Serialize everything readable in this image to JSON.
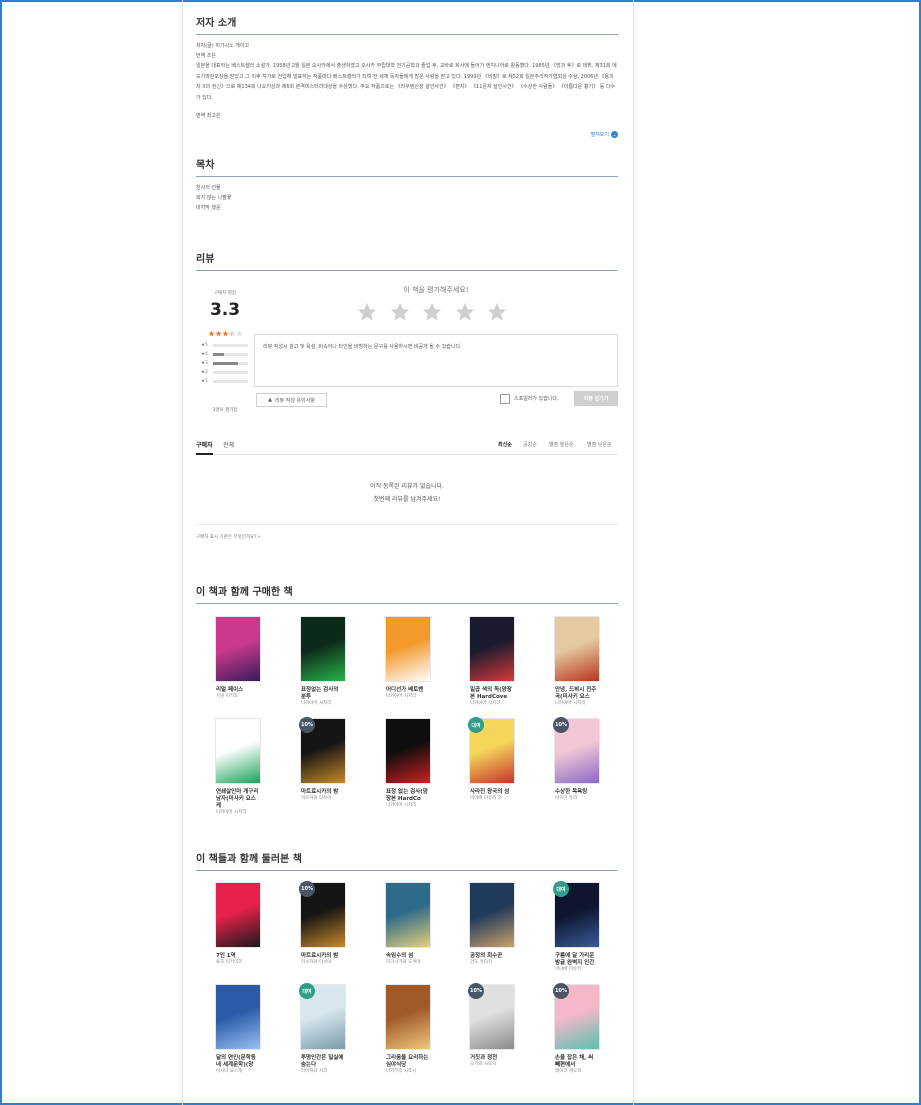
{
  "author_section": {
    "title": "저자 소개",
    "author_line": "저자(글) 히가시노 게이고",
    "translator_line": "번역 조은",
    "bio": "일본을 대표하는 베스트셀러 소설가. 1958년 2월 일본 오사카에서 출생하였고 오사카 부립대학 전기공학과 졸업 후, 교바로 회사에 들어가 엔지니어로 활동했다. 1985년 《방과 후》로 데뷔, 제31회 에도가와란포상을 받았고 그 이후 작가로 전업해 발표하는 작품마다 베스트셀러가 되며 전 세계 독자들에게 많은 사랑을 받고 있다. 1999년 《비밀》로 제52회 일본추리작가협회상 수상, 2006년 《용의자 X의 헌신》으로 제134회 나오키상과 제6회 본격미스터리대상을 수상했다. 주요 작품으로는 《라쿠텐산장 살인사건》 《편지》 《11문자 살인사건》 《수상한 사람들》 《아름다운 흉기》 등 다수가 있다.",
    "translator_label": "번역 최고은",
    "more_label": "펼쳐보기"
  },
  "toc_section": {
    "title": "목차",
    "items": [
      "천사의 선물",
      "희지 않는 나팔꽃",
      "마지막 행운"
    ]
  },
  "review_section": {
    "title": "리뷰",
    "rating_label": "구매자 별점",
    "rating_value": "3.3",
    "rating_stars": 3.3,
    "distribution": [
      {
        "label": "5",
        "fraction": 0.0
      },
      {
        "label": "4",
        "fraction": 0.3
      },
      {
        "label": "3",
        "fraction": 0.7
      },
      {
        "label": "2",
        "fraction": 0.0
      },
      {
        "label": "1",
        "fraction": 0.0
      }
    ],
    "participants_label": "3명이 평가함",
    "prompt": "이 책을 평가해주세요!",
    "textarea_placeholder": "리뷰 작성시 광고 및 욕설, 비속어나 타인을 비방하는 문구를 사용하시면 비공개 될 수 있습니다.",
    "guide_button": "리뷰 작성 유의사항",
    "spoiler_label": "스포일러가 있습니다.",
    "submit_button": "리뷰 남기기",
    "tabs": [
      "구매자",
      "전체"
    ],
    "sorts": [
      "최신순",
      "공감순",
      "별점 높은순",
      "별점 낮은순"
    ],
    "empty_line1": "아직 등록된 리뷰가 없습니다.",
    "empty_line2": "첫번째 리뷰를 남겨주세요!",
    "footer_note": "구매자 표시 기준은 무엇인가요? »",
    "star_empty_color": "#cfcfcf",
    "star_fill_color": "#f27a2a"
  },
  "bought_together": {
    "title": "이 책과 함께 구매한 책",
    "books": [
      {
        "title": "리얼 페이스",
        "author": "치넨 미키토",
        "badge": "",
        "badge_color": "",
        "colors": [
          "#c93a8c",
          "#3a1a5a"
        ]
      },
      {
        "title": "표정없는 검사의 분투",
        "author": "나카야마 시치리",
        "badge": "",
        "badge_color": "",
        "colors": [
          "#0c2a1a",
          "#29b34a"
        ]
      },
      {
        "title": "어디선가 베토벤",
        "author": "나카야마 시치리",
        "badge": "",
        "badge_color": "",
        "colors": [
          "#f39a2a",
          "#ffffff"
        ]
      },
      {
        "title": "일곱 색의 독(양장본 HardCove",
        "author": "나카야마 시치리",
        "badge": "",
        "badge_color": "",
        "colors": [
          "#1a1a2e",
          "#d63a3a"
        ]
      },
      {
        "title": "안녕, 드뷔시 전주곡(미사키 요스",
        "author": "나카야마 시치리",
        "badge": "",
        "badge_color": "",
        "colors": [
          "#e5c9a0",
          "#b8351d"
        ]
      },
      {
        "title": "연쇄살인마 개구리남자(미사키 요스케",
        "author": "나카야마 시치리",
        "badge": "",
        "badge_color": "",
        "colors": [
          "#ffffff",
          "#1aa35a"
        ]
      },
      {
        "title": "마트료시카의 밤",
        "author": "미쓰카와 다쓰야",
        "badge": "10%",
        "badge_color": "#4a5566",
        "colors": [
          "#151515",
          "#c88a2a"
        ]
      },
      {
        "title": "표정 없는 검사(양장본 HardCo",
        "author": "나카야마 시치리",
        "badge": "",
        "badge_color": "",
        "colors": [
          "#0e0e0e",
          "#d02020"
        ]
      },
      {
        "title": "사라진 왕국의 성",
        "author": "미야베 미유키 외",
        "badge": "대여",
        "badge_color": "#2e9e8a",
        "colors": [
          "#f5d55a",
          "#c8332a"
        ]
      },
      {
        "title": "수상한 목욕탕",
        "author": "아즈마 유리",
        "badge": "10%",
        "badge_color": "#4a5566",
        "colors": [
          "#f2c6d4",
          "#8a6ac8"
        ]
      }
    ]
  },
  "viewed_together": {
    "title": "이 책들과 함께 둘러본 책",
    "books": [
      {
        "title": "7인 1역",
        "author": "류조 미키미코",
        "badge": "",
        "badge_color": "",
        "colors": [
          "#e5204a",
          "#1a1a1a"
        ]
      },
      {
        "title": "마트료시카의 밤",
        "author": "미쓰카와 다쓰야",
        "badge": "10%",
        "badge_color": "#4a5566",
        "colors": [
          "#151515",
          "#c88a2a"
        ]
      },
      {
        "title": "속임수의 섬",
        "author": "히가시가와 도쿠야",
        "badge": "",
        "badge_color": "",
        "colors": [
          "#2e6b8a",
          "#e6d07a"
        ]
      },
      {
        "title": "공정의 회수꾼",
        "author": "안도 유타카",
        "badge": "",
        "badge_color": "",
        "colors": [
          "#203a5a",
          "#c8a06a"
        ]
      },
      {
        "title": "구름에 달 가리운 밤글 완벽지 인간",
        "author": "미야베 미유키",
        "badge": "대여",
        "badge_color": "#2e9e8a",
        "colors": [
          "#0d1530",
          "#3a5a9a"
        ]
      },
      {
        "title": "달의 연인(문학동네 세계문학)(양",
        "author": "아사다 요스케",
        "badge": "",
        "badge_color": "",
        "colors": [
          "#2a5aa8",
          "#9ac0f0"
        ]
      },
      {
        "title": "투명인간은 밀실에 숨는다",
        "author": "아이자와 사코",
        "badge": "대여",
        "badge_color": "#2e9e8a",
        "colors": [
          "#d8e6ee",
          "#7a9aaa"
        ]
      },
      {
        "title": "그리움을 요리하는 심야식당",
        "author": "나카무라 사토시",
        "badge": "",
        "badge_color": "",
        "colors": [
          "#a05a2a",
          "#f0c87a"
        ]
      },
      {
        "title": "거짓과 정전",
        "author": "모기와 사토시",
        "badge": "10%",
        "badge_color": "#4a5566",
        "colors": [
          "#e0e0e0",
          "#8a8a8a"
        ]
      },
      {
        "title": "손을 잡은 채, 써 빼편에서",
        "author": "레이코 세오코",
        "badge": "10%",
        "badge_color": "#4a5566",
        "colors": [
          "#f4b8c8",
          "#5ac0b0"
        ]
      }
    ]
  }
}
